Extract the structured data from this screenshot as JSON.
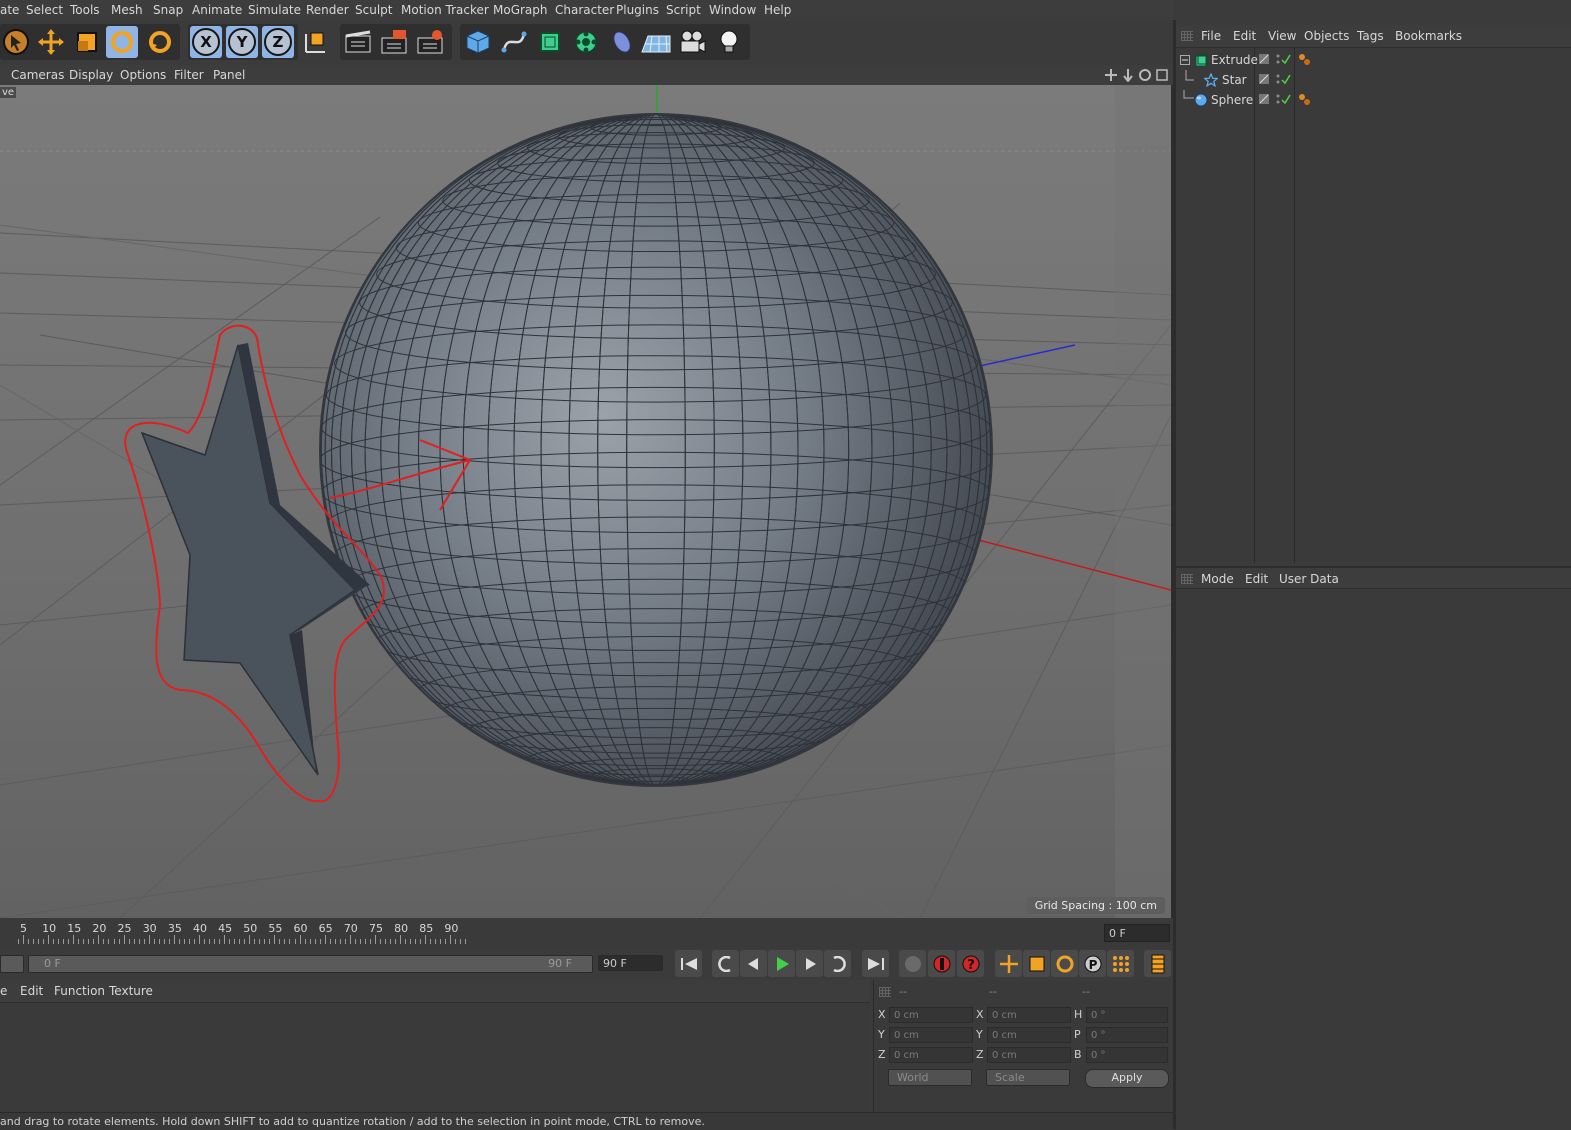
{
  "menubar": {
    "items": [
      "ate",
      "Select",
      "Tools",
      "Mesh",
      "Snap",
      "Animate",
      "Simulate",
      "Render",
      "Sculpt",
      "Motion Tracker",
      "MoGraph",
      "Character",
      "Plugins",
      "Script",
      "Window",
      "Help"
    ]
  },
  "toolbar": {
    "icons": [
      "move-cursor-icon",
      "move-icon",
      "scale-icon",
      "rotate-icon",
      "rotate-alt-icon",
      "x-axis-icon",
      "y-axis-icon",
      "z-axis-icon",
      "coordinate-system-icon",
      "render-view-icon",
      "render-picture-viewer-icon",
      "render-settings-icon",
      "cube-icon",
      "spline-icon",
      "subdivision-icon",
      "cloner-icon",
      "deformer-icon",
      "floor-icon",
      "camera-icon",
      "light-icon"
    ],
    "axis_x": "X",
    "axis_y": "Y",
    "axis_z": "Z"
  },
  "viewport_menu": {
    "items": [
      "Cameras",
      "Display",
      "Options",
      "Filter",
      "Panel"
    ],
    "camera_label": "ve",
    "grid_spacing": "Grid Spacing : 100 cm"
  },
  "timeline": {
    "ticks": [
      "5",
      "10",
      "15",
      "20",
      "25",
      "30",
      "35",
      "40",
      "45",
      "50",
      "55",
      "60",
      "65",
      "70",
      "75",
      "80",
      "85",
      "90"
    ],
    "current_frame": "0 F",
    "range_start": "0 F",
    "range_end": "90 F",
    "end_frame": "90 F"
  },
  "material_menu": {
    "items": [
      "e",
      "Edit",
      "Function",
      "Texture"
    ]
  },
  "coordinates": {
    "headers": [
      "--",
      "--",
      "--"
    ],
    "rows": [
      {
        "pos_label": "X",
        "pos": "0 cm",
        "size_label": "X",
        "size": "0 cm",
        "rot_label": "H",
        "rot": "0 °"
      },
      {
        "pos_label": "Y",
        "pos": "0 cm",
        "size_label": "Y",
        "size": "0 cm",
        "rot_label": "P",
        "rot": "0 °"
      },
      {
        "pos_label": "Z",
        "pos": "0 cm",
        "size_label": "Z",
        "size": "0 cm",
        "rot_label": "B",
        "rot": "0 °"
      }
    ],
    "space": "World",
    "mode": "Scale",
    "apply": "Apply"
  },
  "status": "and drag to rotate elements. Hold down SHIFT to add to quantize rotation / add to the selection in point mode, CTRL to remove.",
  "object_manager": {
    "menu": [
      "File",
      "Edit",
      "View",
      "Objects",
      "Tags",
      "Bookmarks"
    ],
    "objects": [
      {
        "name": "Extrude",
        "icon": "extrude-icon"
      },
      {
        "name": "Star",
        "icon": "star-spline-icon"
      },
      {
        "name": "Sphere",
        "icon": "sphere-icon"
      }
    ]
  },
  "attribute_manager": {
    "menu": [
      "Mode",
      "Edit",
      "User Data"
    ]
  },
  "colors": {
    "accent_highlight": "#8eb5e6",
    "annotation_red": "#e02020",
    "ui_bg": "#3b3b3b"
  }
}
